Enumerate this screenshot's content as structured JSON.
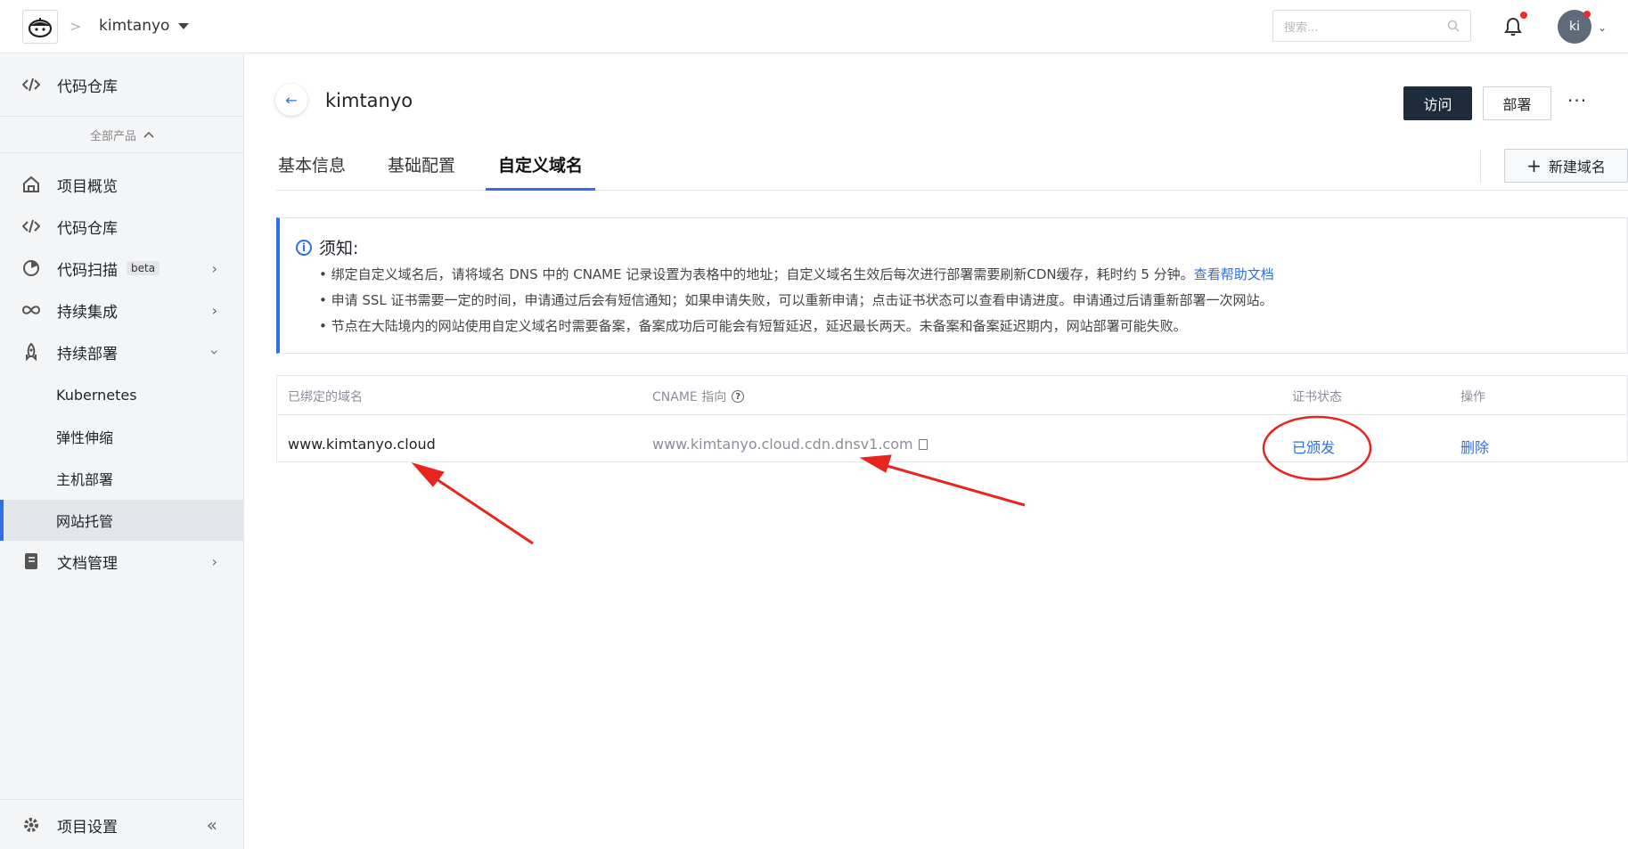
{
  "header": {
    "breadcrumb_sep": ">",
    "project_name": "kimtanyo",
    "search_placeholder": "搜索...",
    "avatar_initials": "ki"
  },
  "sidebar": {
    "top_item": "代码仓库",
    "all_products": "全部产品",
    "items": [
      {
        "label": "项目概览",
        "icon": "home-icon"
      },
      {
        "label": "代码仓库",
        "icon": "code-icon"
      },
      {
        "label": "代码扫描",
        "icon": "scan-icon",
        "badge": "beta"
      },
      {
        "label": "持续集成",
        "icon": "infinity-icon"
      },
      {
        "label": "持续部署",
        "icon": "rocket-icon"
      }
    ],
    "deploy_subitems": [
      "Kubernetes",
      "弹性伸缩",
      "主机部署",
      "网站托管"
    ],
    "docs": "文档管理",
    "settings": "项目设置"
  },
  "main": {
    "title": "kimtanyo",
    "visit_label": "访问",
    "deploy_label": "部署",
    "tabs": [
      "基本信息",
      "基础配置",
      "自定义域名"
    ],
    "active_tab": "自定义域名",
    "new_domain_label": "新建域名",
    "notice": {
      "title": "须知:",
      "line1": "• 绑定自定义域名后，请将域名 DNS 中的 CNAME 记录设置为表格中的地址；自定义域名生效后每次进行部署需要刷新CDN缓存，耗时约 5 分钟。",
      "line1_link": "查看帮助文档",
      "line2": "• 申请 SSL 证书需要一定的时间，申请通过后会有短信通知；如果申请失败，可以重新申请；点击证书状态可以查看申请进度。申请通过后请重新部署一次网站。",
      "line3": "• 节点在大陆境内的网站使用自定义域名时需要备案，备案成功后可能会有短暂延迟，延迟最长两天。未备案和备案延迟期内，网站部署可能失败。"
    },
    "table": {
      "headers": [
        "已绑定的域名",
        "CNAME 指向",
        "证书状态",
        "操作"
      ],
      "rows": [
        {
          "domain": "www.kimtanyo.cloud",
          "cname": "www.kimtanyo.cloud.cdn.dnsv1.com",
          "cert_status": "已颁发",
          "action": "删除"
        }
      ]
    }
  },
  "colors": {
    "accent": "#2f6fe4",
    "annotation": "#e8241f",
    "dark_button": "#1d2b3a"
  }
}
